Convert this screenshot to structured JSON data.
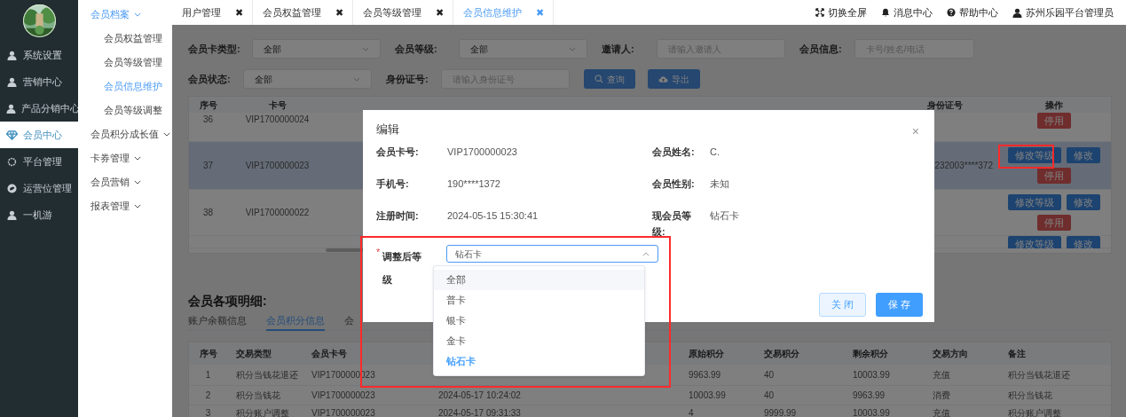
{
  "sidebar": {
    "items": [
      {
        "label": "系统设置",
        "selected": false
      },
      {
        "label": "营销中心",
        "selected": false
      },
      {
        "label": "产品分销中心",
        "selected": false
      },
      {
        "label": "会员中心",
        "selected": true
      },
      {
        "label": "平台管理",
        "selected": false
      },
      {
        "label": "运营位管理",
        "selected": false
      },
      {
        "label": "一机游",
        "selected": false
      }
    ]
  },
  "submenu": {
    "items": [
      {
        "label": "会员档案",
        "expanded": true,
        "children": [
          {
            "label": "会员权益管理",
            "selected": false
          },
          {
            "label": "会员等级管理",
            "selected": false
          },
          {
            "label": "会员信息维护",
            "selected": true
          },
          {
            "label": "会员等级调整",
            "selected": false
          }
        ]
      },
      {
        "label": "会员积分成长值",
        "expanded": false
      },
      {
        "label": "卡券管理",
        "expanded": false
      },
      {
        "label": "会员营销",
        "expanded": false
      },
      {
        "label": "报表管理",
        "expanded": false
      }
    ]
  },
  "tabs": [
    {
      "label": "用户管理",
      "close": "✖",
      "selected": false
    },
    {
      "label": "会员权益管理",
      "close": "✖",
      "selected": false
    },
    {
      "label": "会员等级管理",
      "close": "✖",
      "selected": false
    },
    {
      "label": "会员信息维护",
      "close": "✖",
      "selected": true
    }
  ],
  "header_actions": [
    {
      "label": "切换全屏"
    },
    {
      "label": "消息中心"
    },
    {
      "label": "帮助中心"
    },
    {
      "label": "苏州乐园平台管理员"
    }
  ],
  "filters": [
    {
      "label": "会员卡类型:",
      "kind": "select",
      "value": "全部"
    },
    {
      "label": "会员等级:",
      "kind": "select",
      "value": "全部"
    },
    {
      "label": "邀请人:",
      "kind": "input",
      "placeholder": "请输入邀请人"
    },
    {
      "label": "会员信息:",
      "kind": "input",
      "placeholder": "卡号/姓名/电话"
    },
    {
      "label": "会员状态:",
      "kind": "select",
      "value": "全部"
    },
    {
      "label": "身份证号:",
      "kind": "input",
      "placeholder": "请输入身份证号"
    }
  ],
  "filter_buttons": [
    {
      "label": "查询"
    },
    {
      "label": "导出"
    }
  ],
  "member_table": {
    "columns": [
      "序号",
      "卡号",
      "身份证号",
      "操作"
    ],
    "rows": [
      {
        "index": "36",
        "card": "VIP1700000024",
        "id_number": "",
        "actions": [
          "停用"
        ]
      },
      {
        "index": "37",
        "card": "VIP1700000023",
        "id_number": "232003****372",
        "actions": [
          "修改等级",
          "修改",
          "停用"
        ],
        "selected": true
      },
      {
        "index": "38",
        "card": "VIP1700000022",
        "id_number": "",
        "actions": [
          "修改等级",
          "修改",
          "停用"
        ],
        "selected": false
      },
      {
        "index": "",
        "card": "",
        "id_number": "",
        "actions": [
          "修改等级",
          "修改"
        ]
      }
    ]
  },
  "details": {
    "title": "会员各项明细:",
    "tabs": [
      {
        "label": "账户余额信息",
        "selected": false
      },
      {
        "label": "会员积分信息",
        "selected": true
      },
      {
        "label": "会",
        "selected": false
      }
    ],
    "columns": [
      "序号",
      "交易类型",
      "会员卡号",
      "",
      "",
      "原始积分",
      "交易积分",
      "剩余积分",
      "交易方向",
      "备注"
    ],
    "rows": [
      [
        "1",
        "积分当钱花退还",
        "VIP1700000023",
        "",
        "",
        "9963.99",
        "40",
        "10003.99",
        "充值",
        "积分当钱花退还"
      ],
      [
        "2",
        "积分当钱花",
        "VIP1700000023",
        "2024-05-17 10:24:02",
        "",
        "10003.99",
        "40",
        "9963.99",
        "消费",
        "积分当钱花"
      ],
      [
        "3",
        "积分账户调整",
        "VIP1700000023",
        "2024-05-17 09:31:33",
        "",
        "4",
        "9999.99",
        "10003.99",
        "充值",
        "积分账户调整"
      ]
    ]
  },
  "dialog": {
    "title": "编辑",
    "close": "×",
    "fields": [
      {
        "label": "会员卡号:",
        "value": "VIP1700000023"
      },
      {
        "label": "会员姓名:",
        "value": "C."
      },
      {
        "label": "手机号:",
        "value": "190****1372"
      },
      {
        "label": "会员性别:",
        "value": "未知"
      },
      {
        "label": "注册时间:",
        "value": "2024-05-15 15:30:41"
      },
      {
        "label": "现会员等级:",
        "value": "钻石卡"
      }
    ],
    "level_field": {
      "required_mark": "*",
      "label": "调整后等级",
      "value": "钻石卡",
      "expanded": true,
      "options": [
        {
          "label": "全部",
          "hovered": true,
          "selected": false
        },
        {
          "label": "普卡",
          "hovered": false,
          "selected": false
        },
        {
          "label": "银卡",
          "hovered": false,
          "selected": false
        },
        {
          "label": "金卡",
          "hovered": false,
          "selected": false
        },
        {
          "label": "钻石卡",
          "hovered": false,
          "selected": true
        }
      ]
    },
    "buttons": [
      {
        "label": "关 闭",
        "kind": "secondary"
      },
      {
        "label": "保 存",
        "kind": "primary"
      }
    ]
  }
}
